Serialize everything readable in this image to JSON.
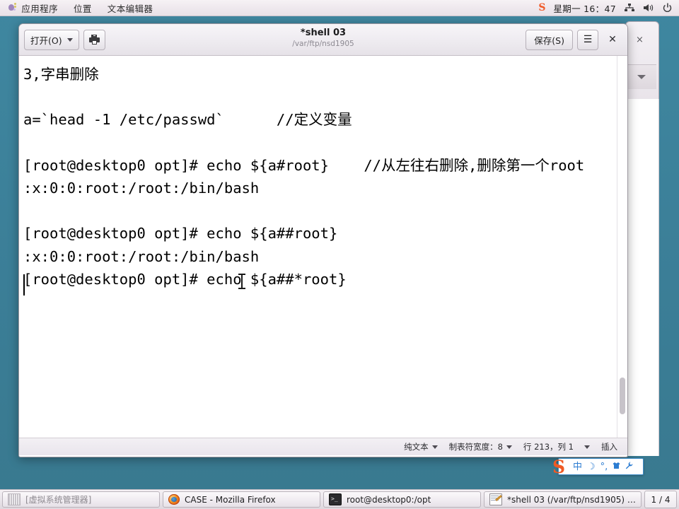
{
  "desktop": {
    "background_color": "#3d839b"
  },
  "top_panel": {
    "menu_items": [
      {
        "label": "应用程序",
        "icon": "gnome-foot-icon"
      },
      {
        "label": "位置"
      },
      {
        "label": "文本编辑器"
      }
    ],
    "tray": {
      "ime_logo": "S",
      "clock": "星期一 16：47",
      "network_icon": "network-icon",
      "volume_icon": "volume-icon",
      "power_icon": "power-icon"
    }
  },
  "background_window": {
    "close_label": "×"
  },
  "gedit": {
    "titlebar": {
      "open_label": "打开(O)",
      "open_caret_icon": "chevron-down-icon",
      "print_icon": "printer-icon",
      "title": "*shell 03",
      "path": "/var/ftp/nsd1905",
      "save_label": "保存(S)",
      "menu_icon": "hamburger-icon",
      "menu_glyph": "☰",
      "close_glyph": "✕"
    },
    "document": {
      "text": "3,字串删除\n\na=`head -1 /etc/passwd`      //定义变量\n\n[root@desktop0 opt]# echo ${a#root}    //从左往右删除,删除第一个root\n:x:0:0:root:/root:/bin/bash\n\n[root@desktop0 opt]# echo ${a##root}\n:x:0:0:root:/root:/bin/bash\n[root@desktop0 opt]# echo ${a##*root}"
    },
    "statusbar": {
      "filetype": "纯文本",
      "filetype_caret_icon": "chevron-down-icon",
      "tabwidth": "制表符宽度：8",
      "tabwidth_caret_icon": "chevron-down-icon",
      "position": "行 213，列 1",
      "position_caret_icon": "chevron-down-icon",
      "insert_mode": "插入"
    }
  },
  "ime_bar": {
    "logo": "S",
    "items": [
      {
        "icon": "chinese-mode-icon",
        "glyph": "中"
      },
      {
        "icon": "moon-icon",
        "glyph": "☽"
      },
      {
        "icon": "punctuation-icon",
        "glyph": "°,"
      },
      {
        "icon": "skin-icon",
        "glyph": "👕"
      },
      {
        "icon": "wrench-icon",
        "glyph": "🔧"
      }
    ]
  },
  "taskbar": {
    "tasks": [
      {
        "label": "[虚拟系统管理器]",
        "icon": "virt-manager-icon",
        "active": false,
        "dim": true
      },
      {
        "label": "CASE - Mozilla Firefox",
        "icon": "firefox-icon",
        "active": false,
        "dim": false
      },
      {
        "label": "root@desktop0:/opt",
        "icon": "terminal-icon",
        "active": false,
        "dim": false
      },
      {
        "label": "*shell 03 (/var/ftp/nsd1905) - ⋯",
        "icon": "gedit-icon",
        "active": true,
        "dim": false
      }
    ],
    "pager": "1 / 4"
  }
}
